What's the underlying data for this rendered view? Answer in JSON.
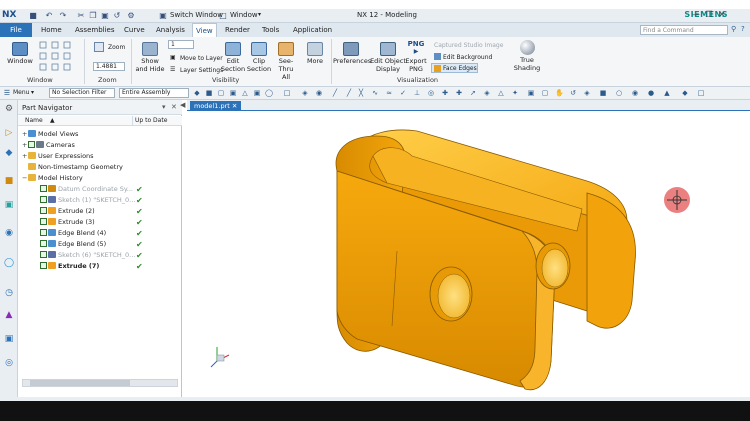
{
  "app": {
    "logo": "NX",
    "title": "NX 12 - Modeling",
    "brand": "SIEMENS",
    "switch_window": "Switch Window",
    "window_menu": "Window",
    "search_placeholder": "Find a Command"
  },
  "tabs": [
    "File",
    "Home",
    "Assemblies",
    "Curve",
    "Analysis",
    "View",
    "Render",
    "Tools",
    "Application"
  ],
  "active_tab": "View",
  "ribbon": {
    "window_btn": "Window",
    "zoom_btn": "Zoom",
    "zoom_value": "1.4881",
    "layer_value": "1",
    "show_hide": [
      "Show",
      "and Hide"
    ],
    "move_to_layer": "Move to Layer",
    "layer_settings": "Layer Settings",
    "edit_section": [
      "Edit",
      "Section"
    ],
    "clip_section": [
      "Clip",
      "Section"
    ],
    "see_thru": [
      "See-Thru",
      "All"
    ],
    "more": "More",
    "preferences": "Preferences",
    "edit_object_display": [
      "Edit Object",
      "Display"
    ],
    "png": "PNG",
    "export_png": [
      "Export",
      "PNG"
    ],
    "captured_studio": "Captured Studio Image",
    "edit_background": "Edit Background",
    "face_edges": "Face Edges",
    "true_shading": [
      "True",
      "Shading"
    ],
    "groups": {
      "window": "Window",
      "zoom": "Zoom",
      "visibility": "Visibility",
      "visualization": "Visualization"
    }
  },
  "toolbar": {
    "menu": "Menu",
    "selection_filter": "No Selection Filter",
    "assembly_scope": "Entire Assembly"
  },
  "navigator": {
    "title": "Part Navigator",
    "col_name": "Name",
    "col_uptodate": "Up to Date",
    "items": [
      {
        "label": "Model Views",
        "level": 0,
        "expander": "+",
        "dim": false,
        "bold": false,
        "check": false,
        "box": false,
        "icon": "views"
      },
      {
        "label": "Cameras",
        "level": 0,
        "expander": "+",
        "dim": false,
        "bold": false,
        "check": false,
        "box": true,
        "icon": "camera"
      },
      {
        "label": "User Expressions",
        "level": 0,
        "expander": "+",
        "dim": false,
        "bold": false,
        "check": false,
        "box": false,
        "icon": "folder"
      },
      {
        "label": "Non-timestamp Geometry",
        "level": 0,
        "expander": "",
        "dim": false,
        "bold": false,
        "check": false,
        "box": false,
        "icon": "folder"
      },
      {
        "label": "Model History",
        "level": 0,
        "expander": "−",
        "dim": false,
        "bold": false,
        "check": false,
        "box": false,
        "icon": "folder"
      },
      {
        "label": "Datum Coordinate Sy...",
        "level": 1,
        "expander": "",
        "dim": true,
        "bold": false,
        "check": true,
        "box": true,
        "icon": "datum"
      },
      {
        "label": "Sketch (1) \"SKETCH_0...",
        "level": 1,
        "expander": "",
        "dim": true,
        "bold": false,
        "check": true,
        "box": true,
        "icon": "sketch"
      },
      {
        "label": "Extrude (2)",
        "level": 1,
        "expander": "",
        "dim": false,
        "bold": false,
        "check": true,
        "box": true,
        "icon": "extrude"
      },
      {
        "label": "Extrude (3)",
        "level": 1,
        "expander": "",
        "dim": false,
        "bold": false,
        "check": true,
        "box": true,
        "icon": "extrude"
      },
      {
        "label": "Edge Blend (4)",
        "level": 1,
        "expander": "",
        "dim": false,
        "bold": false,
        "check": true,
        "box": true,
        "icon": "blend"
      },
      {
        "label": "Edge Blend (5)",
        "level": 1,
        "expander": "",
        "dim": false,
        "bold": false,
        "check": true,
        "box": true,
        "icon": "blend"
      },
      {
        "label": "Sketch (6) \"SKETCH_0...",
        "level": 1,
        "expander": "",
        "dim": true,
        "bold": false,
        "check": true,
        "box": true,
        "icon": "sketch"
      },
      {
        "label": "Extrude (7)",
        "level": 1,
        "expander": "",
        "dim": false,
        "bold": true,
        "check": true,
        "box": true,
        "icon": "extrude"
      }
    ]
  },
  "graphics": {
    "tab_name": "model1.prt"
  },
  "colors": {
    "accent": "#2b72b8",
    "part_fill": "#f2a60a",
    "part_dark": "#c07b00",
    "part_light": "#ffc53a",
    "check": "#2a8a2a",
    "cursor": "#e05050"
  }
}
